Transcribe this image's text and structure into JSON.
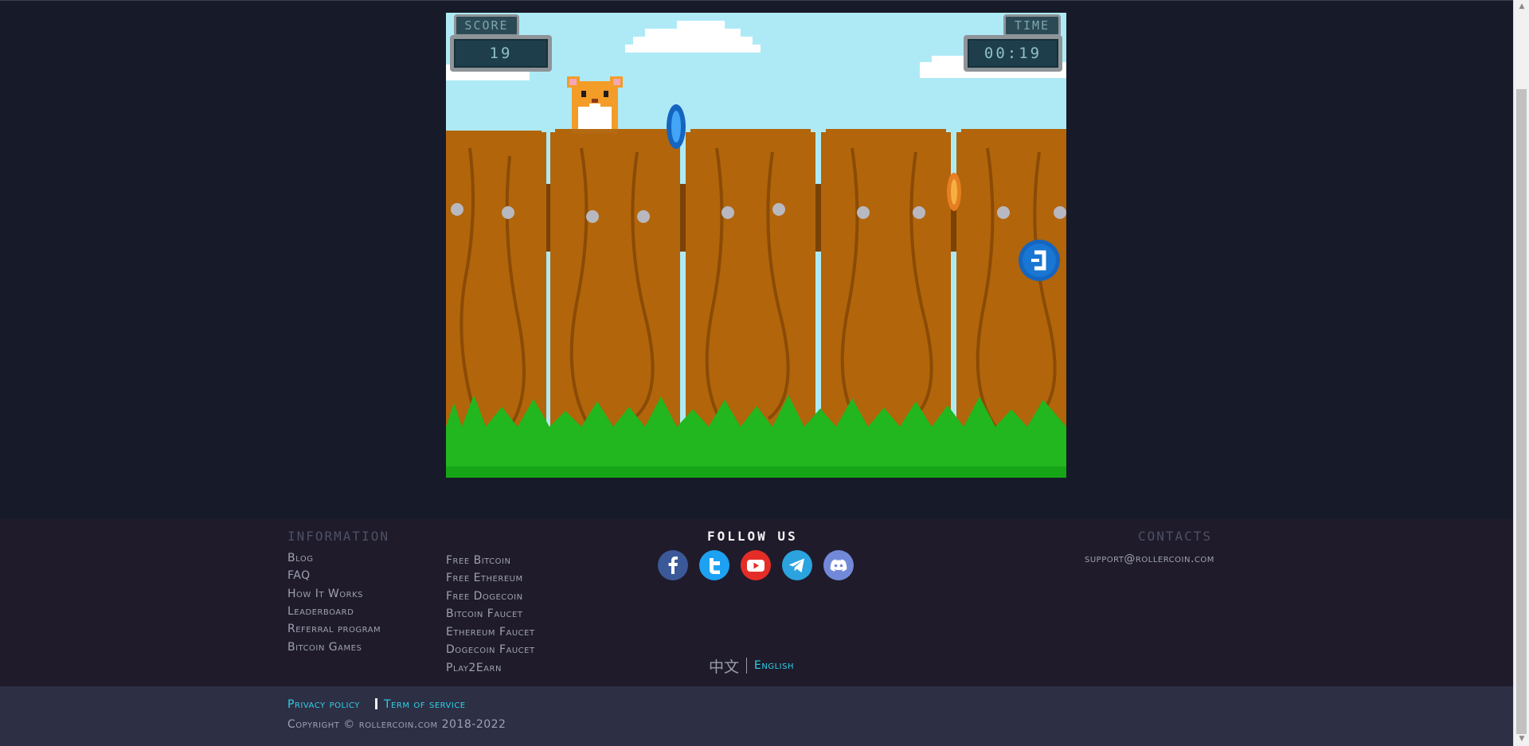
{
  "game": {
    "score_label": "SCORE",
    "score_value": "19",
    "time_label": "TIME",
    "time_value": "00:19"
  },
  "footer": {
    "information_heading": "Information",
    "info_links": [
      "Blog",
      "FAQ",
      "How It Works",
      "Leaderboard",
      "Referral program",
      "Bitcoin Games"
    ],
    "free_links": [
      "Free Bitcoin",
      "Free Ethereum",
      "Free Dogecoin",
      "Bitcoin Faucet",
      "Ethereum Faucet",
      "Dogecoin Faucet",
      "Play2Earn"
    ],
    "follow_heading": "Follow us",
    "social_icons": [
      "facebook-icon",
      "twitter-icon",
      "youtube-icon",
      "telegram-icon",
      "discord-icon"
    ],
    "contacts_heading": "Contacts",
    "support_email": "support@rollercoin.com",
    "lang_chinese": "中文",
    "lang_english": "English"
  },
  "bottom": {
    "privacy": "Privacy policy",
    "terms": "Term of service",
    "copyright": "Copyright © rollercoin.com 2018-2022"
  },
  "colors": {
    "page_bg": "#171a28",
    "footer_bg": "#1f1b2a",
    "bottom_bg": "#2d2f45",
    "accent_cyan": "#2fd0e8",
    "fence_wood": "#b2650a",
    "grass": "#22b61f",
    "sky": "#aeeaf6"
  }
}
